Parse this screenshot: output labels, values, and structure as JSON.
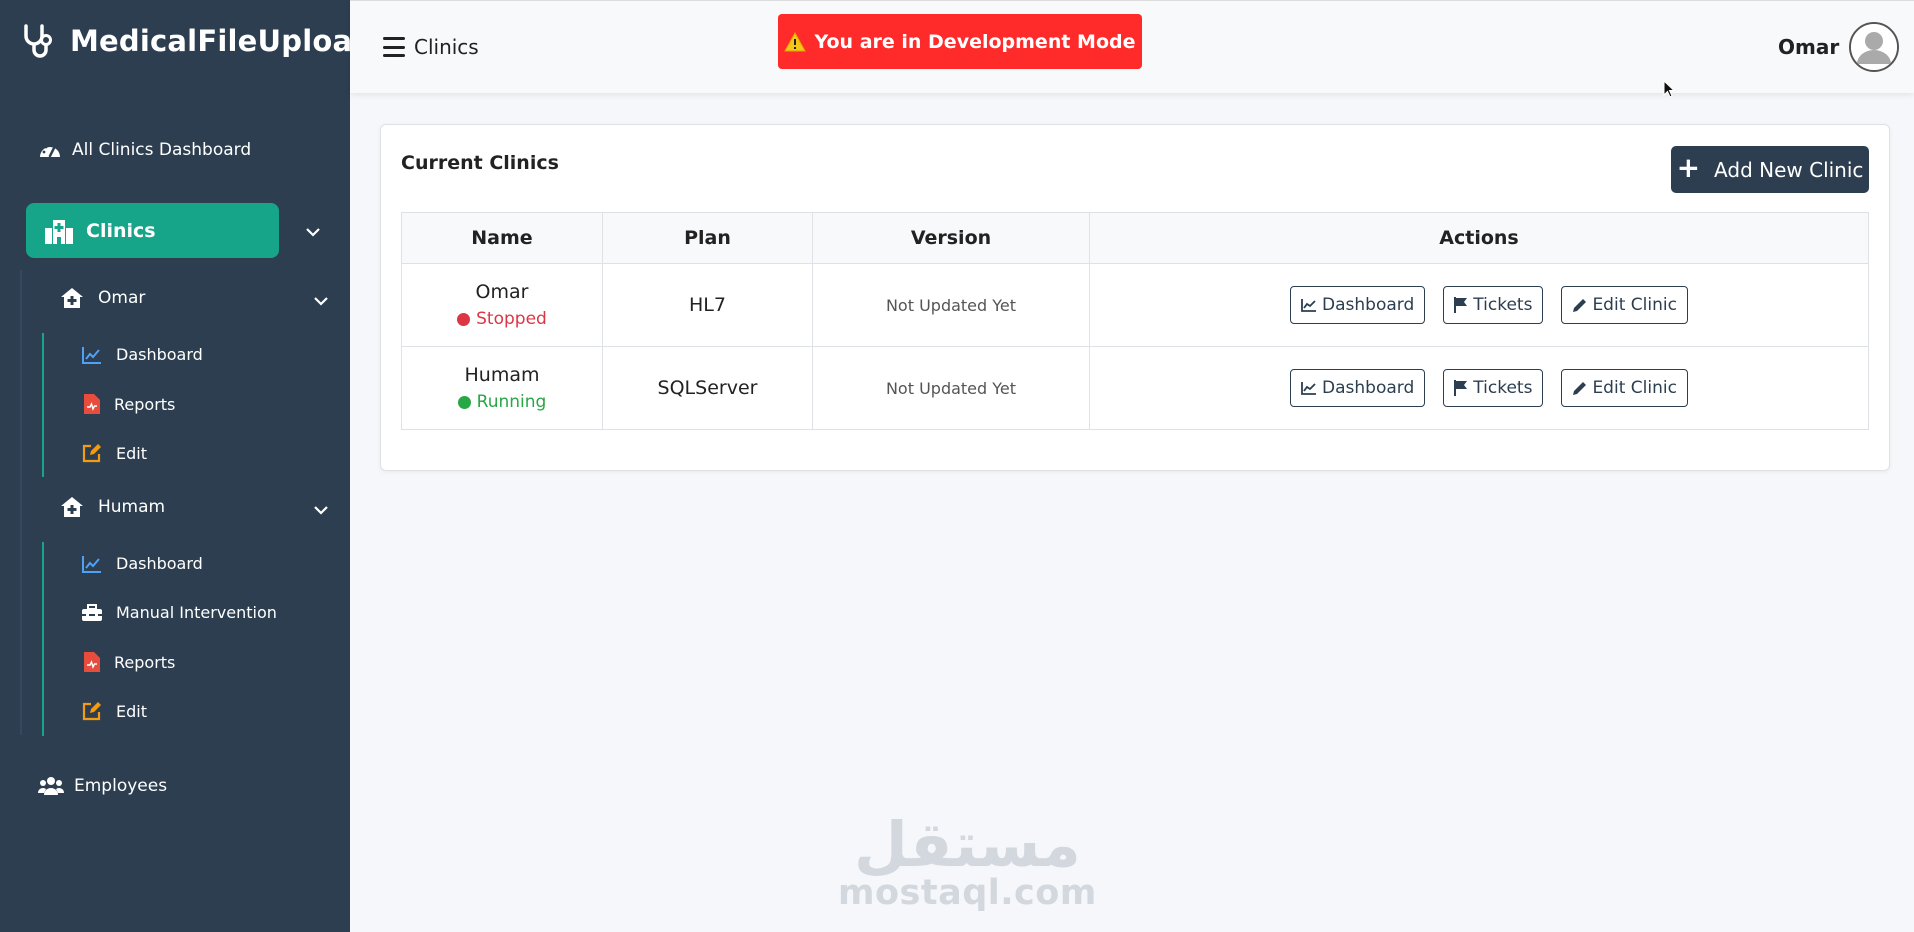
{
  "brand": {
    "name": "MedicalFileUpload",
    "icon": "stethoscope-icon"
  },
  "sidebar": {
    "all_clinics": "All Clinics Dashboard",
    "clinics": "Clinics",
    "clinic_groups": [
      {
        "name": "Omar",
        "items": [
          "Dashboard",
          "Reports",
          "Edit"
        ]
      },
      {
        "name": "Humam",
        "items": [
          "Dashboard",
          "Manual Intervention",
          "Reports",
          "Edit"
        ]
      }
    ],
    "employees": "Employees"
  },
  "topbar": {
    "page": "Clinics",
    "dev_banner": "You are in Development Mode",
    "user": "Omar"
  },
  "card": {
    "title": "Current Clinics",
    "add_button": "Add New Clinic",
    "columns": [
      "Name",
      "Plan",
      "Version",
      "Actions"
    ],
    "rows": [
      {
        "name": "Omar",
        "status": "Stopped",
        "plan": "HL7",
        "version": "Not Updated Yet"
      },
      {
        "name": "Humam",
        "status": "Running",
        "plan": "SQLServer",
        "version": "Not Updated Yet"
      }
    ],
    "actions": [
      "Dashboard",
      "Tickets",
      "Edit Clinic"
    ]
  },
  "watermark": {
    "arabic": "مستقل",
    "latin": "mostaql.com"
  },
  "colors": {
    "sidebar_bg": "#2c3e50",
    "accent": "#17a589",
    "danger": "#ff2a2a",
    "stopped": "#dc3545",
    "running": "#28a745",
    "icon_blue": "#4ea1f3",
    "icon_red": "#e74c3c",
    "icon_orange": "#f39c12"
  }
}
